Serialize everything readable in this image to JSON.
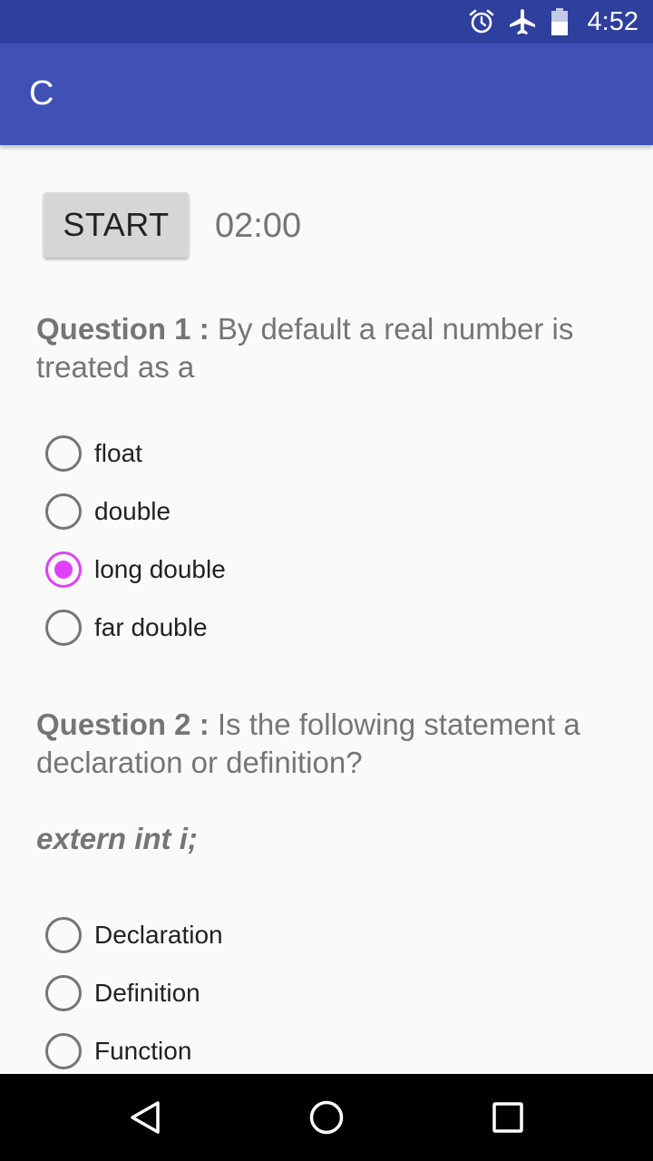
{
  "status_bar": {
    "time": "4:52",
    "icons": [
      "alarm-icon",
      "airplane-mode-icon",
      "battery-icon"
    ]
  },
  "app_bar": {
    "title": "C"
  },
  "quiz": {
    "start_label": "START",
    "timer": "02:00",
    "questions": [
      {
        "label": "Question 1 :",
        "text": " By default a real number is treated as a",
        "options": [
          {
            "label": "float",
            "selected": false
          },
          {
            "label": "double",
            "selected": false
          },
          {
            "label": "long double",
            "selected": true
          },
          {
            "label": "far double",
            "selected": false
          }
        ]
      },
      {
        "label": "Question 2 :",
        "text": " Is the following statement a declaration or definition?",
        "code": "extern int i;",
        "options": [
          {
            "label": "Declaration",
            "selected": false
          },
          {
            "label": "Definition",
            "selected": false
          },
          {
            "label": "Function",
            "selected": false
          }
        ]
      }
    ]
  },
  "colors": {
    "status_bar": "#2f3f9e",
    "app_bar": "#3f51b5",
    "accent": "#e040fb",
    "text_secondary": "#757575"
  },
  "nav_bar": {
    "icons": [
      "back-icon",
      "home-icon",
      "recents-icon"
    ]
  }
}
